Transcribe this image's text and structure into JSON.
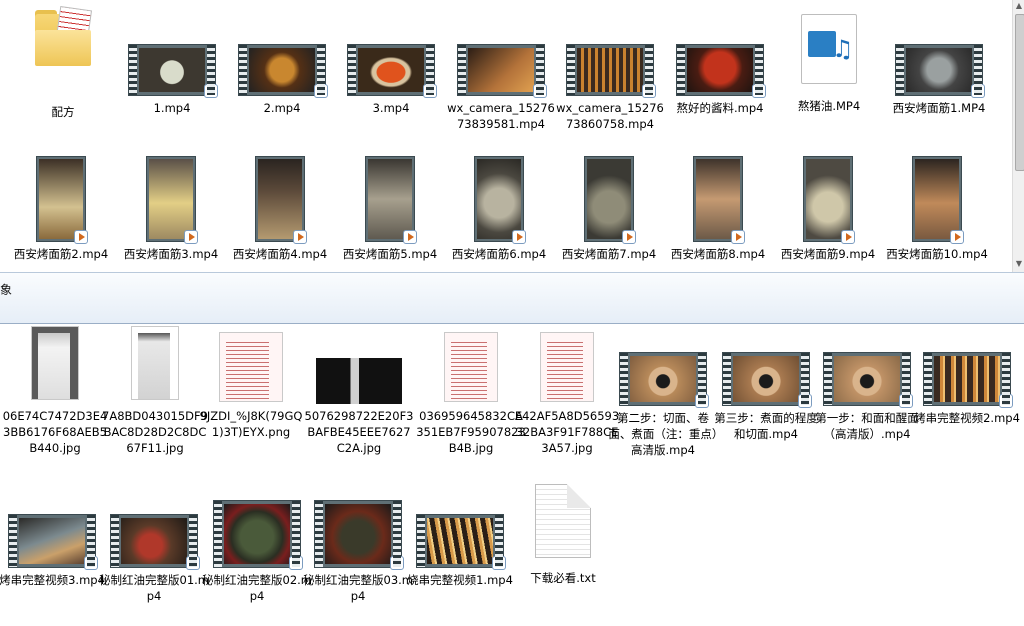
{
  "status_bar": {
    "selection_text": "象"
  },
  "pane1": {
    "items": [
      {
        "label": "配方",
        "icon": "folder-icon"
      },
      {
        "label": "1.mp4",
        "icon": "video-icon"
      },
      {
        "label": "2.mp4",
        "icon": "video-icon"
      },
      {
        "label": "3.mp4",
        "icon": "video-icon"
      },
      {
        "label": "wx_camera_1527673839581.mp4",
        "icon": "video-icon"
      },
      {
        "label": "wx_camera_1527673860758.mp4",
        "icon": "video-icon"
      },
      {
        "label": "熬好的酱料.mp4",
        "icon": "video-icon"
      },
      {
        "label": "熬猪油.MP4",
        "icon": "media-file-icon"
      },
      {
        "label": "西安烤面筋1.MP4",
        "icon": "video-icon"
      },
      {
        "label": "西安烤面筋2.mp4",
        "icon": "video-icon"
      },
      {
        "label": "西安烤面筋3.mp4",
        "icon": "video-icon"
      },
      {
        "label": "西安烤面筋4.mp4",
        "icon": "video-icon"
      },
      {
        "label": "西安烤面筋5.mp4",
        "icon": "video-icon"
      },
      {
        "label": "西安烤面筋6.mp4",
        "icon": "video-icon"
      },
      {
        "label": "西安烤面筋7.mp4",
        "icon": "video-icon"
      },
      {
        "label": "西安烤面筋8.mp4",
        "icon": "video-icon"
      },
      {
        "label": "西安烤面筋9.mp4",
        "icon": "video-icon"
      },
      {
        "label": "西安烤面筋10.mp4",
        "icon": "video-icon"
      }
    ]
  },
  "pane2": {
    "items": [
      {
        "label": "06E74C7472D3E43BB6176F68AEB5B440.jpg",
        "icon": "image-icon"
      },
      {
        "label": "7A8BD043015DF9BAC8D28D2C8DC67F11.jpg",
        "icon": "image-icon"
      },
      {
        "label": "9JZDI_%J8K(79GQ1)3T)EYX.png",
        "icon": "image-icon"
      },
      {
        "label": "5076298722E20F3BAFBE45EEE7627C2A.jpg",
        "icon": "image-icon"
      },
      {
        "label": "036959645832CA351EB7F95907823B4B.jpg",
        "icon": "image-icon"
      },
      {
        "label": "E42AF5A8D5659332BA3F91F788CE3A57.jpg",
        "icon": "image-icon"
      },
      {
        "label": "第二步：切面、卷面、煮面（注：重点）高清版.mp4",
        "icon": "video-icon"
      },
      {
        "label": "第三步：煮面的程度和切面.mp4",
        "icon": "video-icon"
      },
      {
        "label": "第一步：和面和醒面（高清版）.mp4",
        "icon": "video-icon"
      },
      {
        "label": "烤串完整视频2.mp4",
        "icon": "video-icon"
      },
      {
        "label": "烤串完整视频3.mp4",
        "icon": "video-icon"
      },
      {
        "label": "秘制红油完整版01.mp4",
        "icon": "video-icon"
      },
      {
        "label": "秘制红油完整版02.mp4",
        "icon": "video-icon"
      },
      {
        "label": "秘制红油完整版03.mp4",
        "icon": "video-icon"
      },
      {
        "label": "烧串完整视频1.mp4",
        "icon": "video-icon"
      },
      {
        "label": "下载必看.txt",
        "icon": "text-file-icon"
      }
    ]
  },
  "colors": {
    "status_band_top": "#fafcfe",
    "status_band_bottom": "#e6eef7",
    "play_badge": "#d2691e"
  }
}
